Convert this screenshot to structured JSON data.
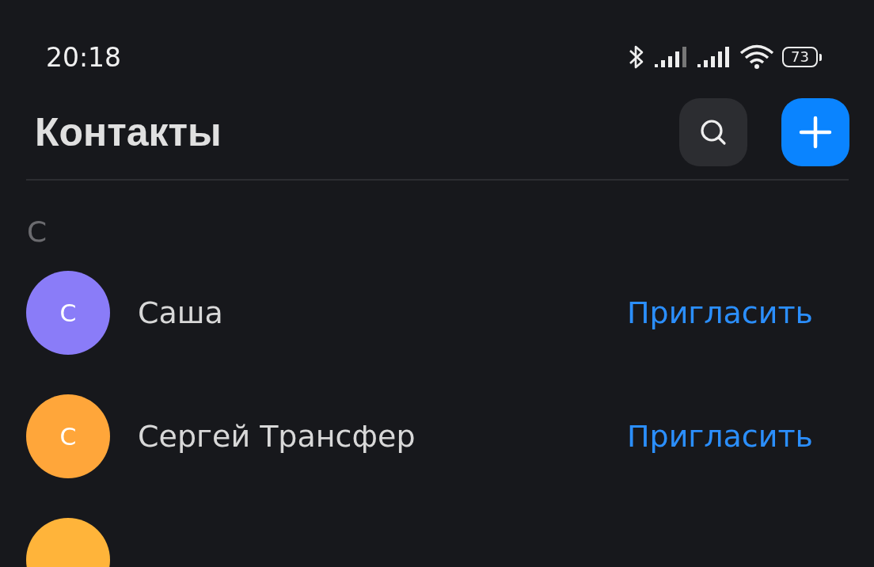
{
  "status_bar": {
    "time": "20:18",
    "battery": "73"
  },
  "header": {
    "title": "Контакты"
  },
  "sections": [
    {
      "letter": "С",
      "contacts": [
        {
          "initial": "С",
          "name": "Саша",
          "action": "Пригласить",
          "color": "#8a7cf8"
        },
        {
          "initial": "С",
          "name": "Сергей Трансфер",
          "action": "Пригласить",
          "color": "#ffa63a"
        },
        {
          "color": "#ffb43a"
        }
      ]
    }
  ]
}
